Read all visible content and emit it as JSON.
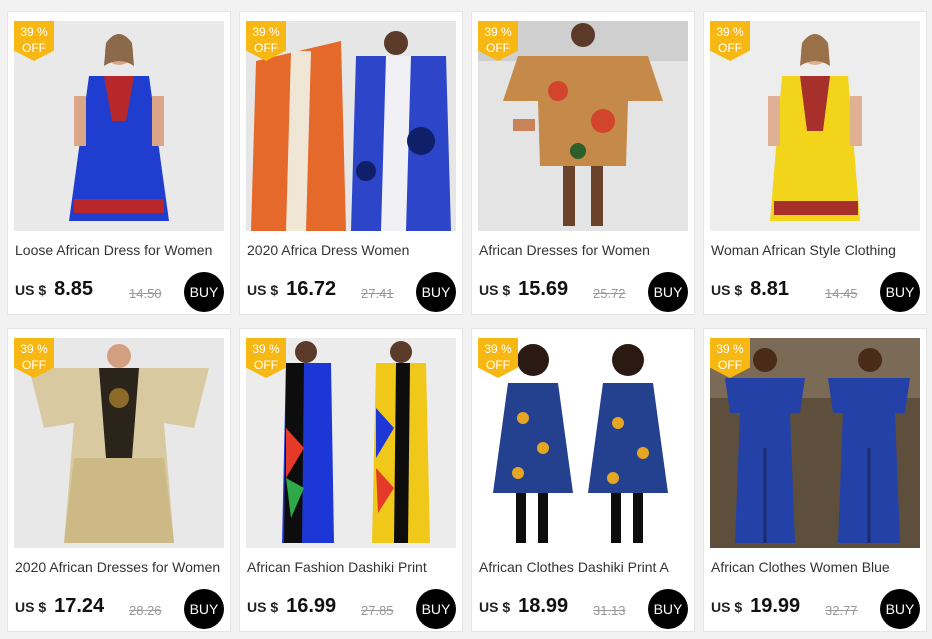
{
  "products": [
    {
      "discount_pct": "39 %",
      "discount_off": "OFF",
      "title": "Loose African Dress for Women",
      "currency": "US $",
      "price": "8.85",
      "old_price": "14.50",
      "buy_label": "BUY",
      "dress_color": "#1f3ed0",
      "accent_color": "#b8272a",
      "bg_color": "#e9e9e9"
    },
    {
      "discount_pct": "39 %",
      "discount_off": "OFF",
      "title": "2020 Africa Dress Women",
      "currency": "US $",
      "price": "16.72",
      "old_price": "27.41",
      "buy_label": "BUY",
      "dress_color": "#e5692a",
      "accent_color": "#2c45c9",
      "bg_color": "#e6e6e6"
    },
    {
      "discount_pct": "39 %",
      "discount_off": "OFF",
      "title": "African Dresses for Women",
      "currency": "US $",
      "price": "15.69",
      "old_price": "25.72",
      "buy_label": "BUY",
      "dress_color": "#c58a4a",
      "accent_color": "#d2452c",
      "bg_color": "#e4e4e4"
    },
    {
      "discount_pct": "39 %",
      "discount_off": "OFF",
      "title": "Woman African Style Clothing",
      "currency": "US $",
      "price": "8.81",
      "old_price": "14.45",
      "buy_label": "BUY",
      "dress_color": "#f2d51a",
      "accent_color": "#a8302a",
      "bg_color": "#ededed"
    },
    {
      "discount_pct": "39 %",
      "discount_off": "OFF",
      "title": "2020 African Dresses for Women",
      "currency": "US $",
      "price": "17.24",
      "old_price": "28.26",
      "buy_label": "BUY",
      "dress_color": "#d8c9a0",
      "accent_color": "#2a241b",
      "bg_color": "#e8e8e8"
    },
    {
      "discount_pct": "39 %",
      "discount_off": "OFF",
      "title": "African Fashion Dashiki Print",
      "currency": "US $",
      "price": "16.99",
      "old_price": "27.85",
      "buy_label": "BUY",
      "dress_color": "#1d37d6",
      "accent_color": "#f0c81a",
      "bg_color": "#ececec"
    },
    {
      "discount_pct": "39 %",
      "discount_off": "OFF",
      "title": "African Clothes Dashiki Print A",
      "currency": "US $",
      "price": "18.99",
      "old_price": "31.13",
      "buy_label": "BUY",
      "dress_color": "#23418f",
      "accent_color": "#e5a623",
      "bg_color": "#ffffff"
    },
    {
      "discount_pct": "39 %",
      "discount_off": "OFF",
      "title": "African Clothes Women Blue",
      "currency": "US $",
      "price": "19.99",
      "old_price": "32.77",
      "buy_label": "BUY",
      "dress_color": "#2441a8",
      "accent_color": "#1a2a6c",
      "bg_color": "#7b6a55"
    }
  ]
}
